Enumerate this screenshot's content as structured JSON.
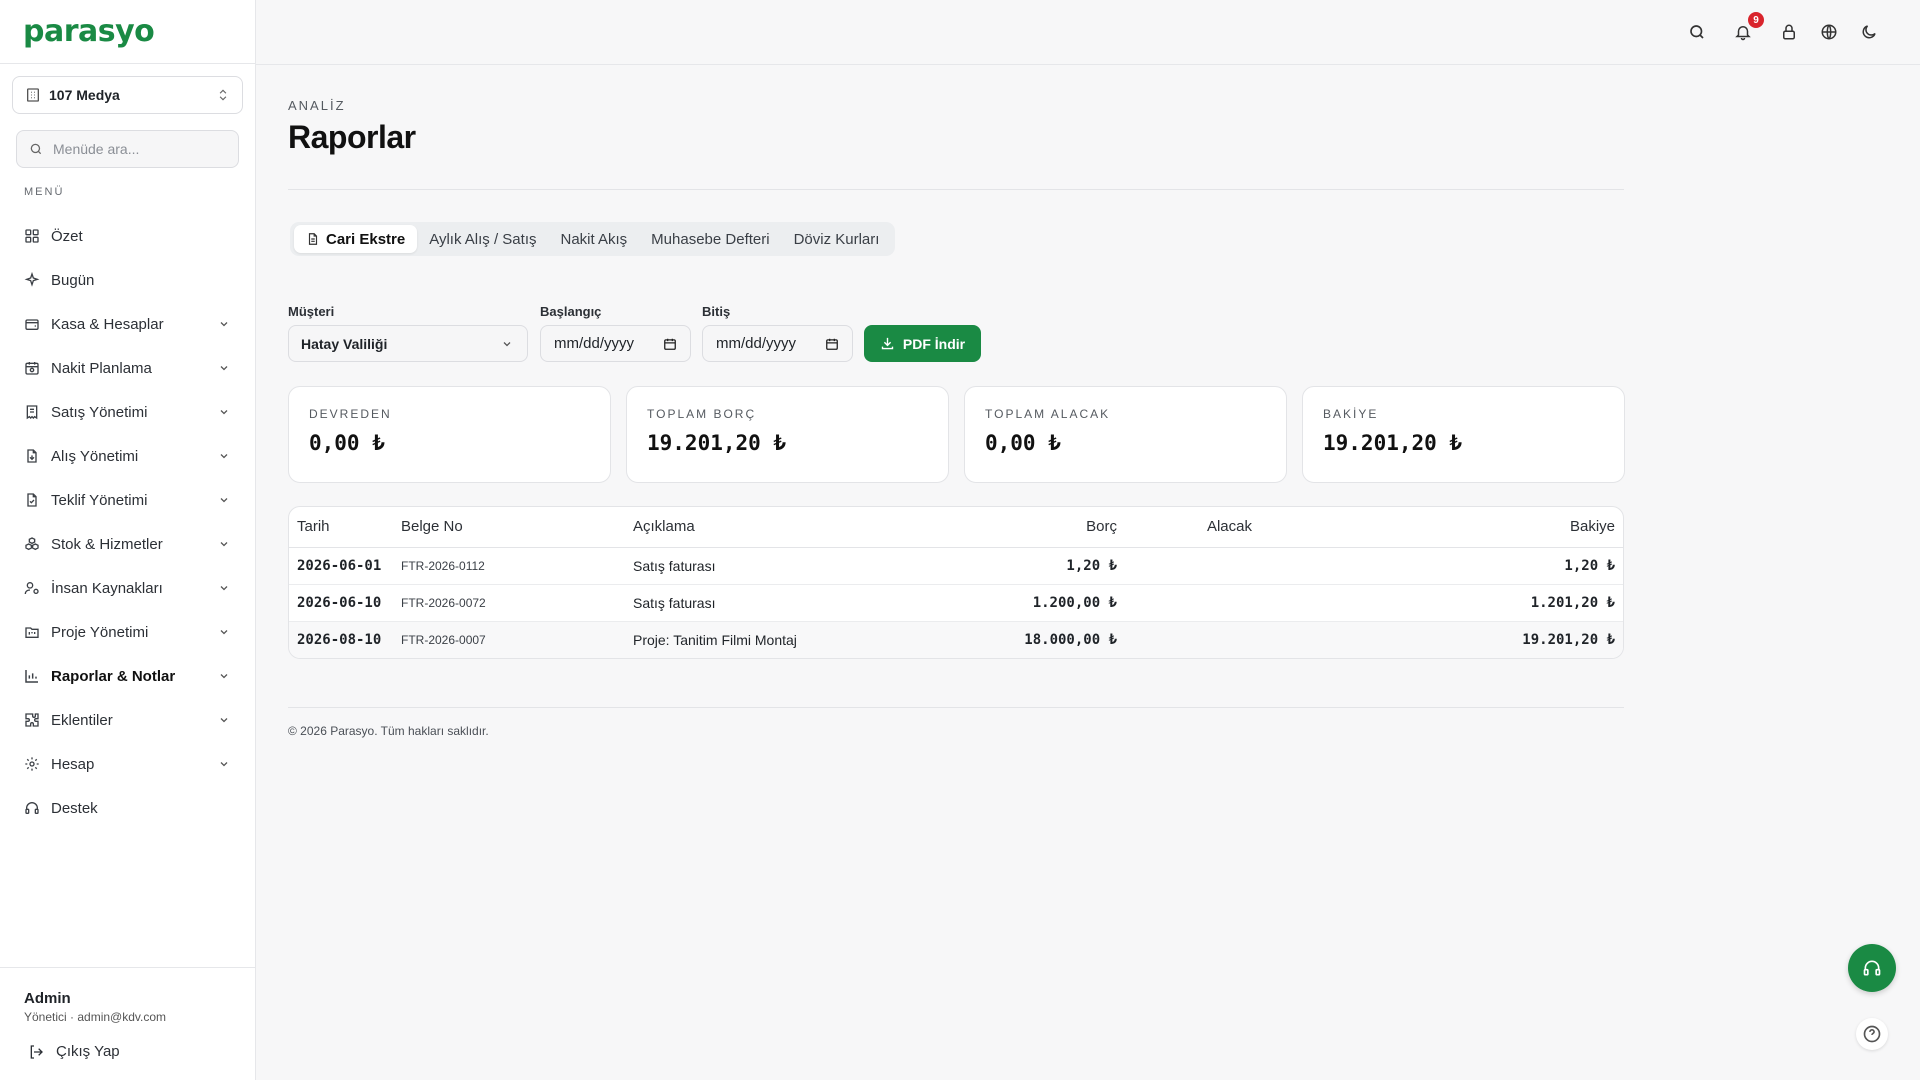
{
  "brand": {
    "logo": "parasyo",
    "color": "#1a8a44"
  },
  "company_selector": {
    "value": "107 Medya"
  },
  "menu_search": {
    "placeholder": "Menüde ara..."
  },
  "menu_label": "MENÜ",
  "nav": [
    {
      "label": "Özet",
      "icon": "grid-icon",
      "has_children": false
    },
    {
      "label": "Bugün",
      "icon": "sparkle-icon",
      "has_children": false
    },
    {
      "label": "Kasa & Hesaplar",
      "icon": "wallet-icon",
      "has_children": true
    },
    {
      "label": "Nakit Planlama",
      "icon": "calendar-clock-icon",
      "has_children": true
    },
    {
      "label": "Satış Yönetimi",
      "icon": "receipt-icon",
      "has_children": true
    },
    {
      "label": "Alış Yönetimi",
      "icon": "file-down-icon",
      "has_children": true
    },
    {
      "label": "Teklif Yönetimi",
      "icon": "file-check-icon",
      "has_children": true
    },
    {
      "label": "Stok & Hizmetler",
      "icon": "boxes-icon",
      "has_children": true
    },
    {
      "label": "İnsan Kaynakları",
      "icon": "user-cog-icon",
      "has_children": true
    },
    {
      "label": "Proje Yönetimi",
      "icon": "folder-kanban-icon",
      "has_children": true
    },
    {
      "label": "Raporlar & Notlar",
      "icon": "bar-chart-icon",
      "has_children": true,
      "active": true
    },
    {
      "label": "Eklentiler",
      "icon": "puzzle-icon",
      "has_children": true
    },
    {
      "label": "Hesap",
      "icon": "gear-icon",
      "has_children": true
    },
    {
      "label": "Destek",
      "icon": "headset-icon",
      "has_children": false
    }
  ],
  "user": {
    "name": "Admin",
    "meta": "Yönetici · admin@kdv.com",
    "logout_label": "Çıkış Yap"
  },
  "topbar": {
    "notification_count": "9"
  },
  "page": {
    "section_label": "ANALİZ",
    "title": "Raporlar"
  },
  "tabs": [
    {
      "label": "Cari Ekstre",
      "active": true
    },
    {
      "label": "Aylık Alış / Satış"
    },
    {
      "label": "Nakit Akış"
    },
    {
      "label": "Muhasebe Defteri"
    },
    {
      "label": "Döviz Kurları"
    }
  ],
  "filters": {
    "customer_label": "Müşteri",
    "customer_value": "Hatay Valiliği",
    "start_label": "Başlangıç",
    "start_placeholder": "mm/dd/yyyy",
    "end_label": "Bitiş",
    "end_placeholder": "mm/dd/yyyy",
    "pdf_label": "PDF İndir"
  },
  "cards": [
    {
      "label": "DEVREDEN",
      "value": "0,00 ₺"
    },
    {
      "label": "TOPLAM BORÇ",
      "value": "19.201,20 ₺"
    },
    {
      "label": "TOPLAM ALACAK",
      "value": "0,00 ₺"
    },
    {
      "label": "BAKİYE",
      "value": "19.201,20 ₺"
    }
  ],
  "table": {
    "headers": [
      "Tarih",
      "Belge No",
      "Açıklama",
      "Borç",
      "Alacak",
      "Bakiye"
    ],
    "rows": [
      {
        "date": "2026-06-01",
        "doc": "FTR-2026-0112",
        "desc": "Satış faturası",
        "debit": "1,20 ₺",
        "credit": "",
        "balance": "1,20 ₺"
      },
      {
        "date": "2026-06-10",
        "doc": "FTR-2026-0072",
        "desc": "Satış faturası",
        "debit": "1.200,00 ₺",
        "credit": "",
        "balance": "1.201,20 ₺"
      },
      {
        "date": "2026-08-10",
        "doc": "FTR-2026-0007",
        "desc": "Proje: Tanitim Filmi Montaj",
        "debit": "18.000,00 ₺",
        "credit": "",
        "balance": "19.201,20 ₺"
      }
    ]
  },
  "footer": "© 2026 Parasyo. Tüm hakları saklıdır."
}
